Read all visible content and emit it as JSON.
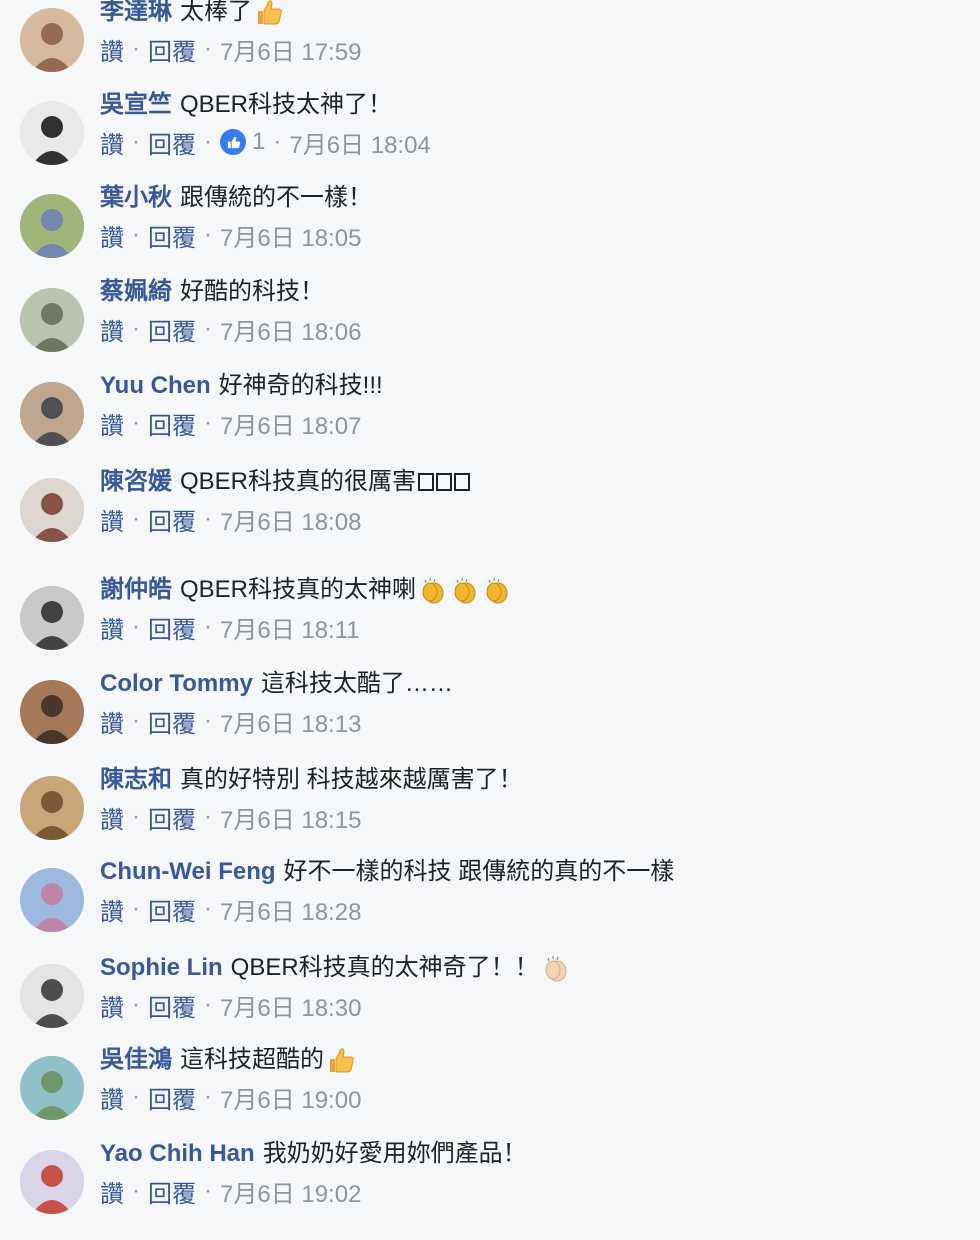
{
  "actions": {
    "like": "讚",
    "reply": "回覆",
    "sep": "·"
  },
  "colors": {
    "author": "#385898",
    "text": "#1d2129",
    "meta": "#90949c",
    "like_badge": "#3b7bf0"
  },
  "comments": [
    {
      "author": "李達琳",
      "text": "太棒了",
      "time": "7月6日 17:59",
      "emoji": "thumbs-up"
    },
    {
      "author": "吳宣竺",
      "text": "QBER科技太神了！",
      "time": "7月6日 18:04",
      "likes": "1"
    },
    {
      "author": "葉小秋",
      "text": "跟傳統的不一樣！",
      "time": "7月6日 18:05"
    },
    {
      "author": "蔡姵綺",
      "text": "好酷的科技！",
      "time": "7月6日 18:06"
    },
    {
      "author": "Yuu Chen",
      "text": "好神奇的科技!!!",
      "time": "7月6日 18:07"
    },
    {
      "author": "陳咨媛",
      "text": "QBER科技真的很厲害",
      "time": "7月6日 18:08",
      "emoji": "missing-glyphs"
    },
    {
      "author": "謝仲皓",
      "text": "QBER科技真的太神喇",
      "time": "7月6日 18:11",
      "emoji": "clapping-hands"
    },
    {
      "author": "Color Tommy",
      "text": "這科技太酷了……",
      "time": "7月6日 18:13"
    },
    {
      "author": "陳志和",
      "text": "真的好特別 科技越來越厲害了！",
      "time": "7月6日 18:15"
    },
    {
      "author": "Chun-Wei Feng",
      "text": "好不一樣的科技 跟傳統的真的不一樣",
      "time": "7月6日 18:28"
    },
    {
      "author": "Sophie Lin",
      "text": "QBER科技真的太神奇了！！",
      "time": "7月6日 18:30",
      "emoji": "clapping-hands-light"
    },
    {
      "author": "吳佳鴻",
      "text": "這科技超酷的",
      "time": "7月6日 19:00",
      "emoji": "thumbs-up"
    },
    {
      "author": "Yao Chih Han",
      "text": "我奶奶好愛用妳們產品！",
      "time": "7月6日 19:02"
    }
  ]
}
